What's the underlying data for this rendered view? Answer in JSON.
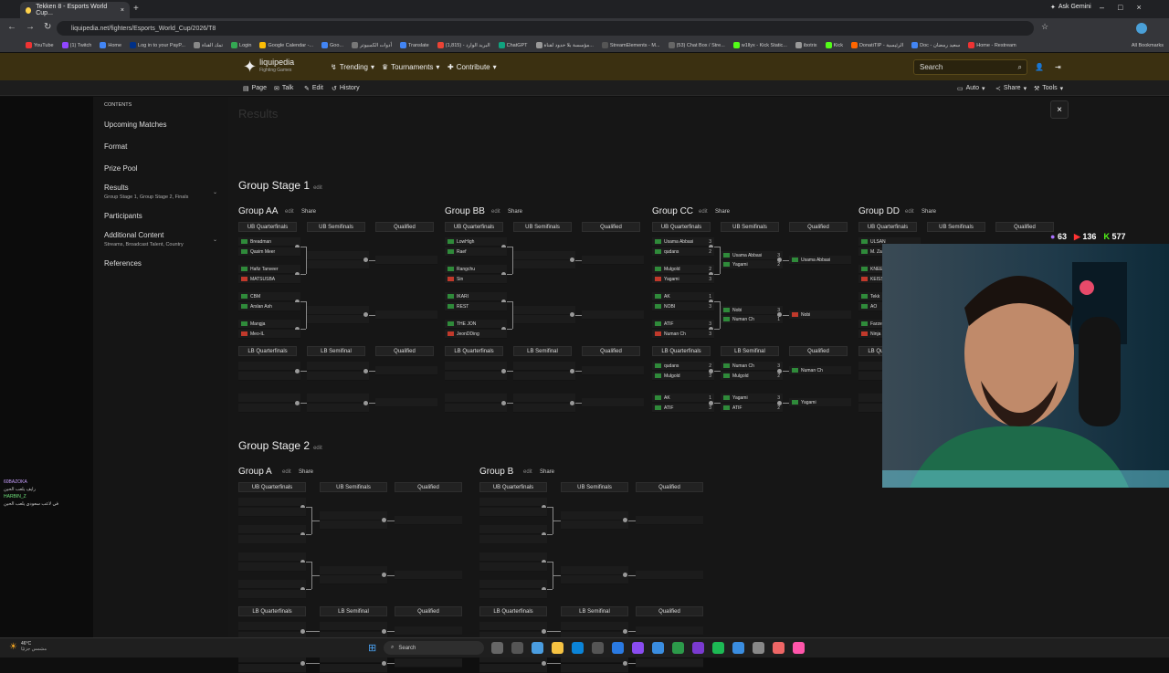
{
  "browser": {
    "tab_title": "Tekken 8 - Esports World Cup...",
    "new_tab": "+",
    "url": "liquipedia.net/fighters/Esports_World_Cup/2026/T8",
    "ask_gemini": "Ask Gemini",
    "all_bookmarks": "All Bookmarks"
  },
  "bookmarks": [
    "YouTube",
    "(1) Twitch",
    "Home",
    "Log in to your PayP...",
    "تمك القناة",
    "Login",
    "Google Calendar -...",
    "Goo...",
    "أدوات الكمبيوتر",
    "Translate",
    "البريد الوارد - (1,815)",
    "ChatGPT",
    "مؤسسة بلا حدود لقناة...",
    "StreamElements - M...",
    "(53) Chat Box / Stre...",
    "w1llyx - Kick Static...",
    "ibotrix",
    "Kick",
    "DonatiTIP - الرئيسية",
    "Doc - سعيد رمضان",
    "Home - Restream"
  ],
  "site": {
    "logo": "liquipedia",
    "logo_sub": "Fighting Games",
    "trending": "Trending",
    "tournaments": "Tournaments",
    "contribute": "Contribute",
    "search": "Search",
    "page": "Page",
    "talk": "Talk",
    "edit": "Edit",
    "history": "History",
    "auto": "Auto",
    "share": "Share",
    "tools": "Tools"
  },
  "toc": {
    "title": "CONTENTS",
    "items": [
      "Upcoming Matches",
      "Format",
      "Prize Pool",
      "Results",
      "Participants",
      "Additional Content",
      "References"
    ],
    "results_sub": "Group Stage 1, Group Stage 2, Finals",
    "additional_sub": "Streams, Broadcast Talent, Country"
  },
  "main": {
    "results": "Results",
    "edit": "edit",
    "share": "Share",
    "close": "×",
    "gs1": "Group Stage 1",
    "gs2": "Group Stage 2",
    "headers": {
      "ubq": "UB Quarterfinals",
      "ubs": "UB Semifinals",
      "q": "Qualified",
      "lbq": "LB Quarterfinals",
      "lbs": "LB Semifinal"
    },
    "groups": [
      {
        "name": "Group AA",
        "players": [
          "Breadman",
          "Qasim Meer",
          "Hafiz Tanveer",
          "MATSUSBA",
          "CBM",
          "Arslan Ash",
          "Mangja",
          "Meo-IL"
        ]
      },
      {
        "name": "Group BB",
        "players": [
          "LowHigh",
          "Raef",
          "Rangchu",
          "Sin",
          "IKARI",
          "REST",
          "THE JON",
          "JeonDDing"
        ]
      },
      {
        "name": "Group CC",
        "players": [
          "Usama Abbasi",
          "qudans",
          "Mulgold",
          "Yagami",
          "AK",
          "NOBI",
          "ATIF",
          "Numan Ch"
        ],
        "ubs": [
          "Usama Abbasi",
          "Yagami",
          "Nobi",
          "Numan Ch"
        ],
        "qual": [
          "Usama Abbasi",
          "Nobi"
        ],
        "lbq": [
          "qudans",
          "Mulgold",
          "AK",
          "ATIF"
        ],
        "lbs": [
          "Numan Ch",
          "Mulgold",
          "Yagami",
          "ATIF"
        ],
        "lbqual": [
          "Numan Ch",
          "Yagami"
        ]
      },
      {
        "name": "Group DD",
        "players": [
          "ULSAN",
          "M. Zai",
          "KNEE",
          "KEISS",
          "Tekk",
          "AO",
          "Farzeen",
          "Ninja"
        ]
      },
      {
        "name": "Group A"
      },
      {
        "name": "Group B"
      }
    ]
  },
  "stream": {
    "stat1": "63",
    "stat2": "136",
    "stat3": "577",
    "chat": [
      "60BAZOKA",
      "رايف يلعب الحين",
      "HARBIN_Z",
      "في لاعب سعودي يلعب الحين"
    ]
  },
  "taskbar": {
    "weather": "46°C",
    "weather_sub": "مشمس جزئيًا",
    "search": "Search"
  }
}
